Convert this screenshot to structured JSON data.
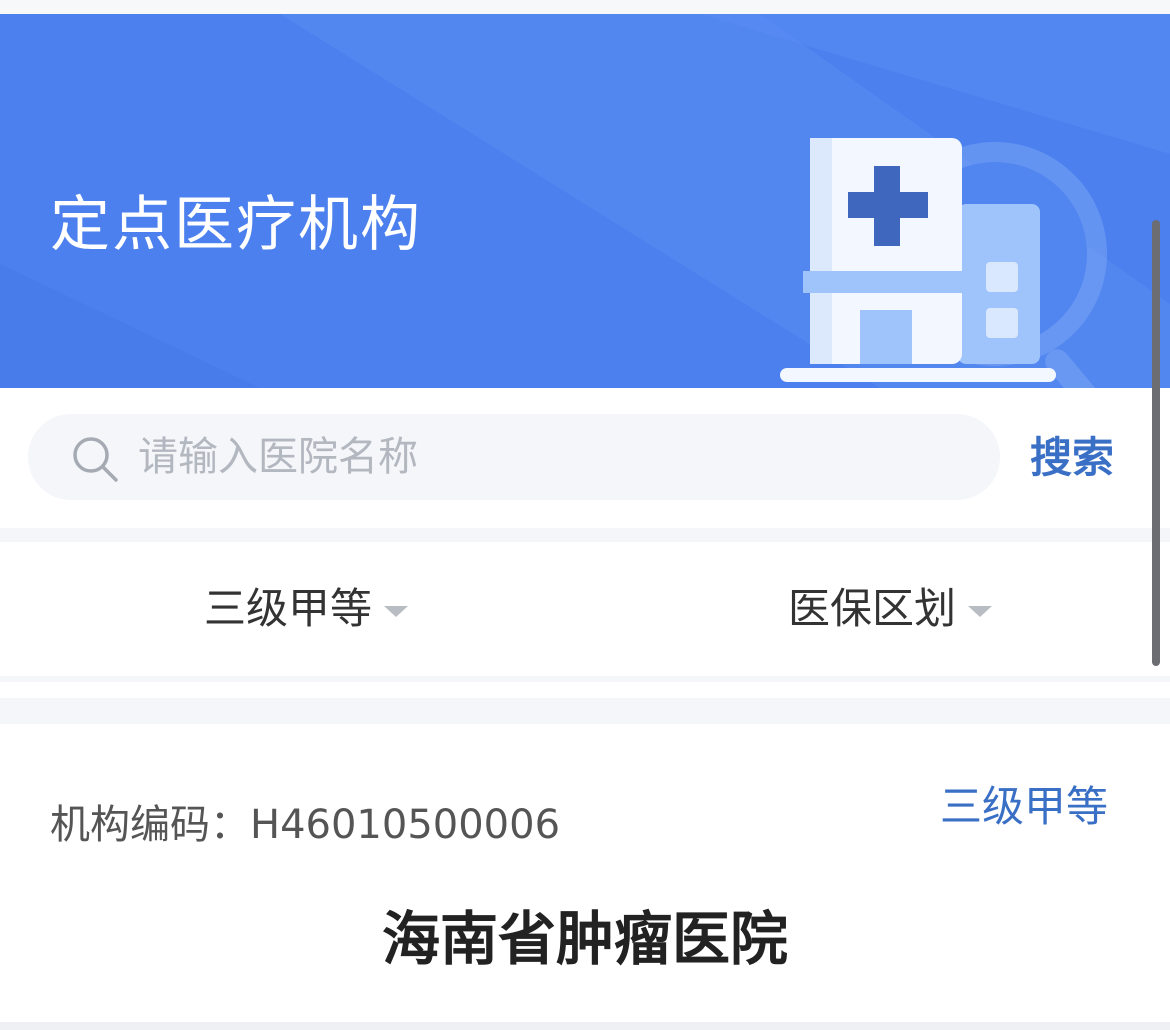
{
  "banner": {
    "title": "定点医疗机构",
    "bg_color": "#4b80ee",
    "illustration": "hospital-building-icon"
  },
  "search": {
    "placeholder": "请输入医院名称",
    "value": "",
    "button_label": "搜索",
    "icon": "search-icon"
  },
  "filters": {
    "level_label": "三级甲等",
    "region_label": "医保区划",
    "caret_icon": "caret-down-icon"
  },
  "hospital": {
    "code_label": "机构编码：",
    "code_value": "H46010500006",
    "grade": "三级甲等",
    "name": "海南省肿瘤医院"
  },
  "colors": {
    "accent": "#3a6fc6",
    "banner": "#4b80ee"
  }
}
